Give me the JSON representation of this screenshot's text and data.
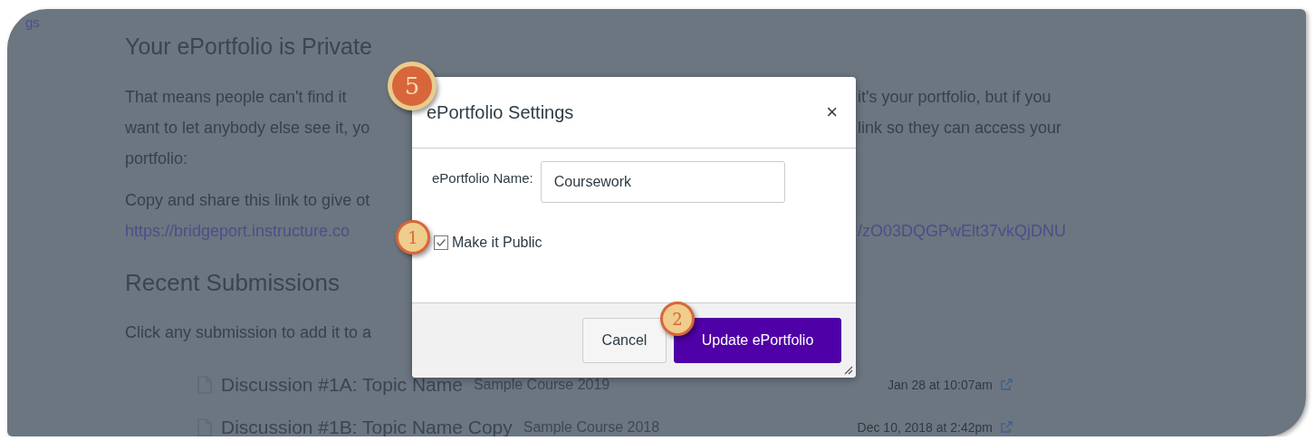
{
  "background_page": {
    "nav_fragment": "gs",
    "heading": "Your ePortfolio is Private",
    "intro_lines": [
      {
        "left": "That means people can't find it",
        "right": "it's your portfolio, but if you"
      },
      {
        "left": "want to let anybody else see it, yo",
        "right": "link so they can access your"
      },
      {
        "left": "portfolio:"
      }
    ],
    "share_line": {
      "left": "Copy and share this link to give ot"
    },
    "share_link": {
      "left": "https://bridgeport.instructure.co",
      "right": "/zO03DQGPwElt37vkQjDNU"
    },
    "submissions_heading": "Recent Submissions",
    "submissions_hint": "Click any submission to add it to a",
    "submissions": [
      {
        "title": "Discussion #1A: Topic Name",
        "course": "Sample Course 2019",
        "date": "Jan 28 at 10:07am"
      },
      {
        "title": "Discussion #1B: Topic Name Copy",
        "course": "Sample Course 2018",
        "date": "Dec 10, 2018 at 2:42pm"
      }
    ]
  },
  "dialog": {
    "title": "ePortfolio Settings",
    "close": "×",
    "name_label": "ePortfolio Name:",
    "name_value": "Coursework",
    "public_checkbox": {
      "label": "Make it Public",
      "checked": true
    },
    "buttons": [
      {
        "label": "Cancel",
        "kind": "secondary"
      },
      {
        "label": "Update ePortfolio",
        "kind": "primary"
      }
    ]
  },
  "callouts": [
    {
      "label": "5",
      "kind": "large"
    },
    {
      "label": "1",
      "kind": "small"
    },
    {
      "label": "2",
      "kind": "small"
    }
  ]
}
